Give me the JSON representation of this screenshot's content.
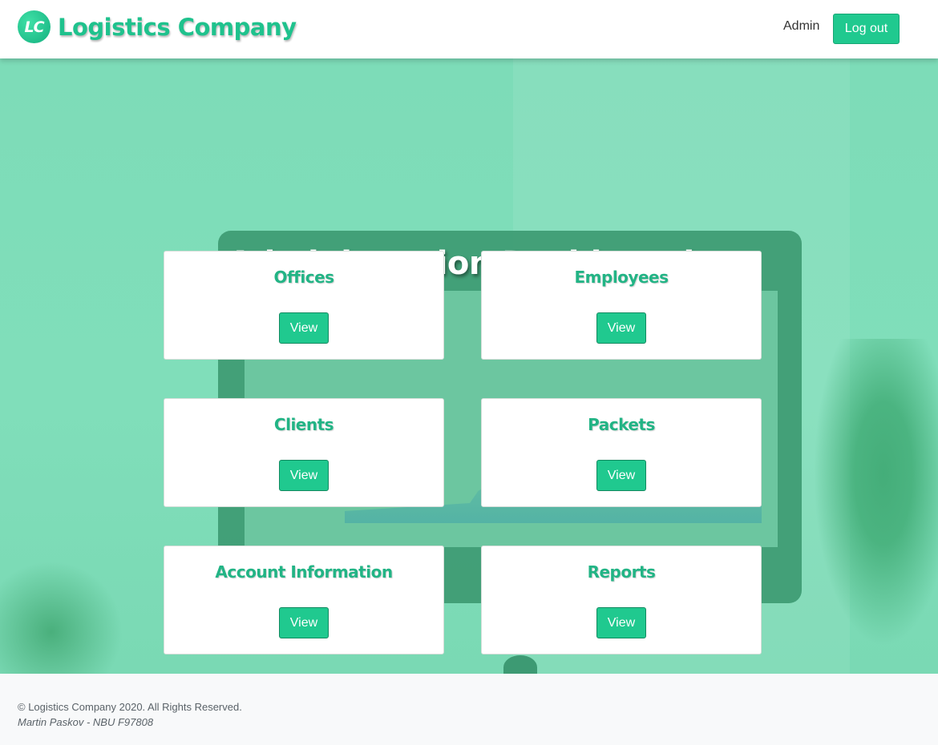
{
  "header": {
    "logo_initials": "LC",
    "brand": "Logistics Company",
    "user": "Admin",
    "logout_label": "Log out"
  },
  "dashboard": {
    "title": "Administration Dashboard",
    "cards": [
      {
        "title": "Offices",
        "button": "View"
      },
      {
        "title": "Employees",
        "button": "View"
      },
      {
        "title": "Clients",
        "button": "View"
      },
      {
        "title": "Packets",
        "button": "View"
      },
      {
        "title": "Account Information",
        "button": "View"
      },
      {
        "title": "Reports",
        "button": "View"
      }
    ]
  },
  "footer": {
    "copyright": "© Logistics Company 2020. All Rights Reserved.",
    "author": "Martin Paskov - NBU F97808"
  },
  "colors": {
    "accent": "#20c98f",
    "accent_text": "#22b485",
    "hero_overlay": "#7ddcb8"
  }
}
